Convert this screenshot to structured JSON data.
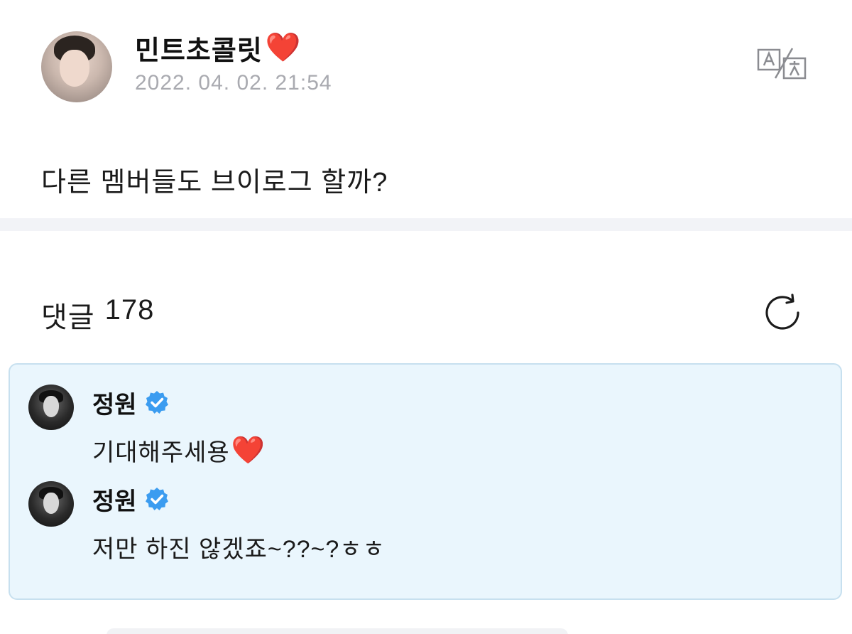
{
  "post": {
    "author_name": "민트초콜릿",
    "author_heart": "❤️",
    "date": "2022. 04. 02. 21:54",
    "body": "다른 멤버들도 브이로그 할까?"
  },
  "comments": {
    "title": "댓글",
    "count": "178",
    "items": [
      {
        "author": "정원",
        "text": "기대해주세용",
        "heart": "❤️"
      },
      {
        "author": "정원",
        "text": "저만 하진 않겠죠~??~?ㅎㅎ"
      }
    ]
  },
  "icons": {
    "translate": "translate-icon",
    "refresh": "refresh-icon",
    "verified": "verified-badge-icon"
  },
  "colors": {
    "accent_verified": "#3b9cf0",
    "comment_box_bg": "#eaf6fd",
    "comment_box_border": "#c7e0ef",
    "date_gray": "#a9aab0",
    "divider": "#f2f3f7",
    "heart": "#e3141f"
  }
}
